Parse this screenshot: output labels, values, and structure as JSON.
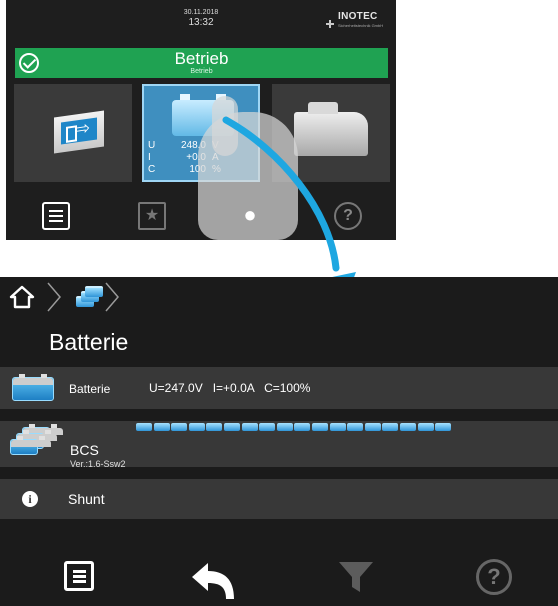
{
  "top_screen": {
    "date": "30.11.2018",
    "time": "13:32",
    "brand": "INOTEC",
    "brand_sub": "Sicherheitstechnik GmbH",
    "status": {
      "title": "Betrieb",
      "subtitle": "Betrieb",
      "color": "#1fa252"
    },
    "tiles": [
      {
        "icon": "exit-sign-icon"
      },
      {
        "icon": "battery-icon",
        "selected": true,
        "readings": [
          {
            "label": "U",
            "value": "248.0",
            "unit": "V"
          },
          {
            "label": "I",
            "value": "+0.0",
            "unit": "A"
          },
          {
            "label": "C",
            "value": "100",
            "unit": "%"
          }
        ]
      },
      {
        "icon": "device-icon"
      }
    ],
    "nav": [
      "list-icon",
      "star-icon",
      "bulb-icon",
      "help-icon"
    ]
  },
  "bottom_screen": {
    "breadcrumb": [
      "home-icon",
      "battery-group-icon"
    ],
    "title": "Batterie",
    "rows": [
      {
        "label": "Batterie",
        "values": "U=247.0V   I=+0.0A   C=100%"
      },
      {
        "label": "BCS",
        "version": "Ver.:1.6-Ssw2",
        "cell_count": 18
      },
      {
        "label": "Shunt"
      }
    ],
    "nav": [
      "list-icon",
      "back-icon",
      "filter-icon",
      "help-icon"
    ]
  },
  "accent_color": "#1ea7e1"
}
